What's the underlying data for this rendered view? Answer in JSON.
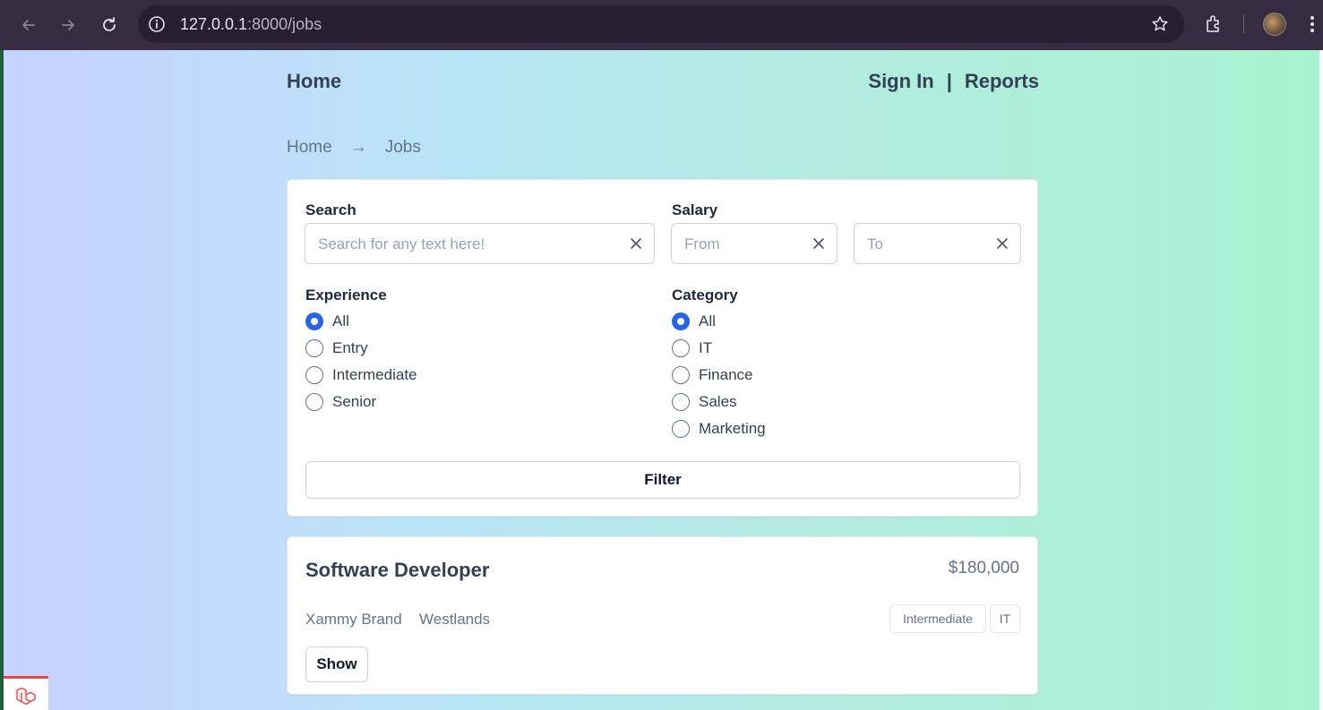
{
  "browser": {
    "url_host": "127.0.0.1",
    "url_rest": ":8000/jobs"
  },
  "nav": {
    "home": "Home",
    "sign_in": "Sign In",
    "separator": "|",
    "reports": "Reports"
  },
  "breadcrumb": {
    "items": [
      "Home",
      "→",
      "Jobs"
    ]
  },
  "filters": {
    "search_label": "Search",
    "search_placeholder": "Search for any text here!",
    "salary_label": "Salary",
    "salary_from_placeholder": "From",
    "salary_to_placeholder": "To",
    "experience_label": "Experience",
    "experience_options": [
      "All",
      "Entry",
      "Intermediate",
      "Senior"
    ],
    "experience_selected": "All",
    "category_label": "Category",
    "category_options": [
      "All",
      "IT",
      "Finance",
      "Sales",
      "Marketing"
    ],
    "category_selected": "All",
    "filter_button": "Filter"
  },
  "jobs": [
    {
      "title": "Software Developer",
      "salary": "$180,000",
      "company": "Xammy Brand",
      "location": "Westlands",
      "tags": [
        "Intermediate",
        "IT"
      ],
      "show_button": "Show"
    }
  ],
  "colors": {
    "accent": "#2563eb",
    "text": "#334155",
    "muted": "#64748b"
  }
}
